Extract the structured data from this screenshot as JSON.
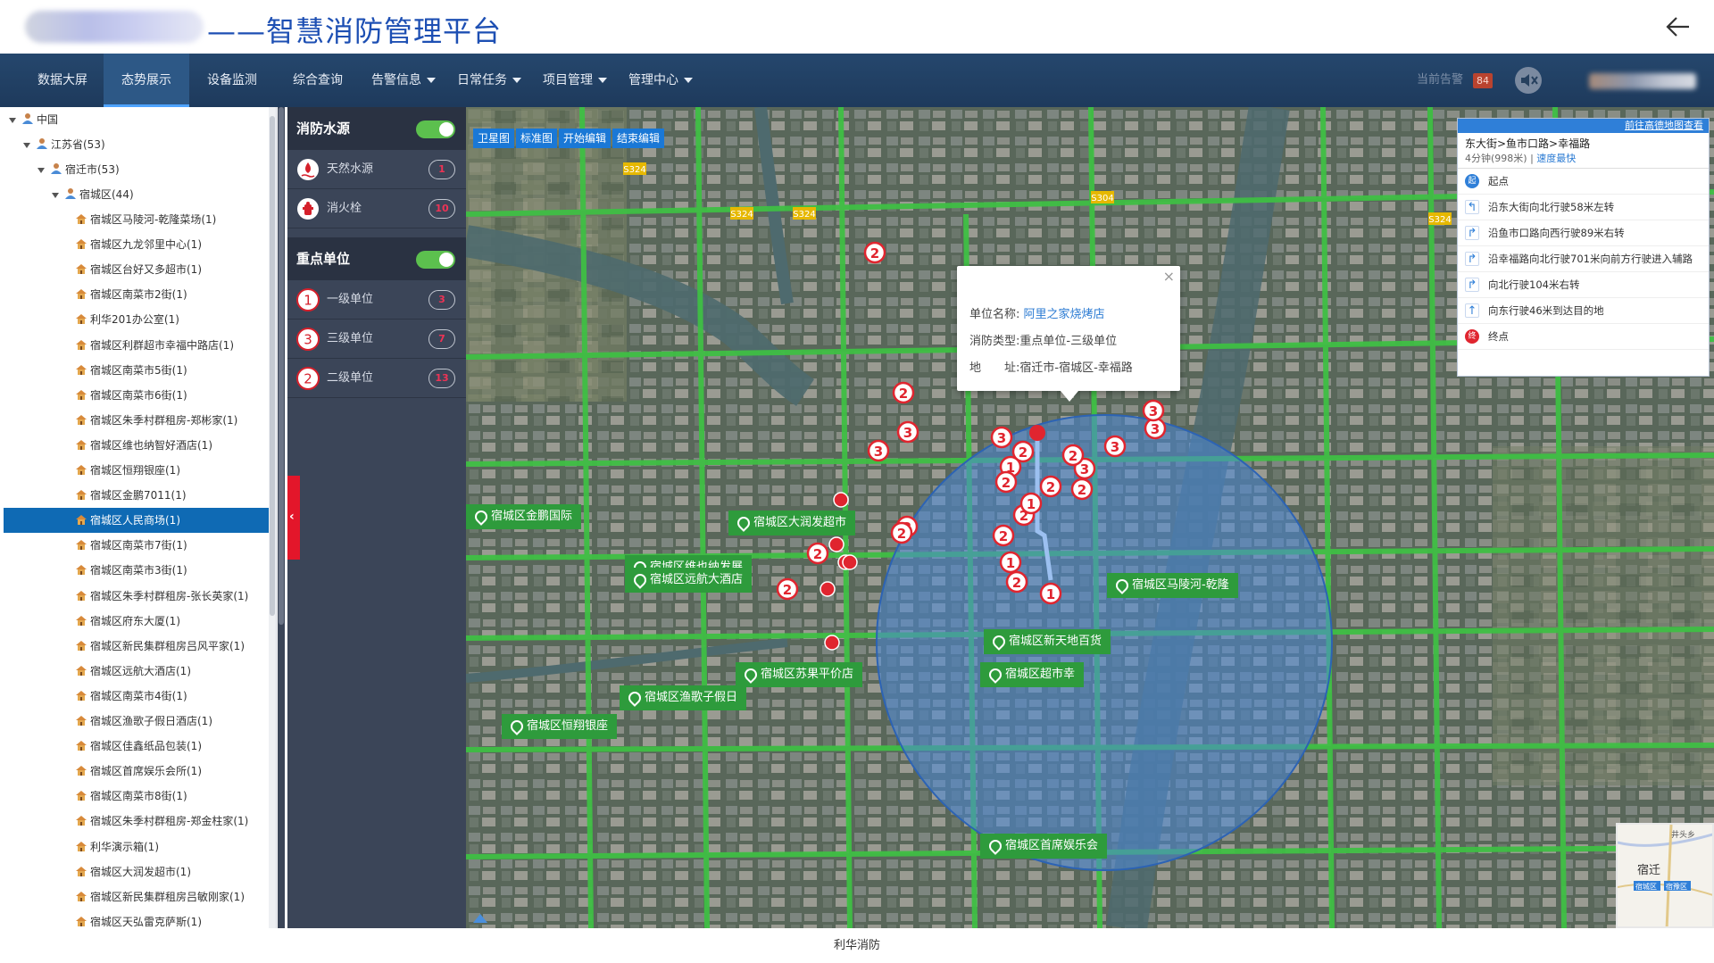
{
  "header": {
    "title": "——智慧消防管理平台"
  },
  "nav": {
    "items": [
      {
        "label": "数据大屏"
      },
      {
        "label": "态势展示"
      },
      {
        "label": "设备监测"
      },
      {
        "label": "综合查询"
      },
      {
        "label": "告警信息"
      },
      {
        "label": "日常任务"
      },
      {
        "label": "项目管理"
      },
      {
        "label": "管理中心"
      }
    ],
    "active": "态势展示",
    "alarm_label": "当前告警",
    "alarm_count": "84"
  },
  "tree": {
    "root": "中国",
    "province": "江苏省(53)",
    "city": "宿迁市(53)",
    "district": "宿城区(44)",
    "items": [
      "宿城区马陵河-乾隆菜场(1)",
      "宿城区九龙邻里中心(1)",
      "宿城区台好又多超市(1)",
      "宿城区南菜市2街(1)",
      "利华201办公室(1)",
      "宿城区利群超市幸福中路店(1)",
      "宿城区南菜市5街(1)",
      "宿城区南菜市6街(1)",
      "宿城区朱季村群租房-郑彬家(1)",
      "宿城区维也纳智好酒店(1)",
      "宿城区恒翔银座(1)",
      "宿城区金鹏7011(1)",
      "宿城区人民商场(1)",
      "宿城区南菜市7街(1)",
      "宿城区南菜市3街(1)",
      "宿城区朱季村群租房-张长英家(1)",
      "宿城区府东大厦(1)",
      "宿城区新民集群租房吕风平家(1)",
      "宿城区远航大酒店(1)",
      "宿城区南菜市4街(1)",
      "宿城区渔歌子假日酒店(1)",
      "宿城区佳鑫纸品包装(1)",
      "宿城区首席娱乐会所(1)",
      "宿城区南菜市8街(1)",
      "宿城区朱季村群租房-郑金柱家(1)",
      "利华演示箱(1)",
      "宿城区大润发超市(1)",
      "宿城区新民集群租房吕敏刚家(1)",
      "宿城区天弘雷克萨斯(1)"
    ],
    "selected": "宿城区人民商场(1)"
  },
  "layers": {
    "water": {
      "title": "消防水源",
      "rows": [
        {
          "label": "天然水源",
          "count": "1"
        },
        {
          "label": "消火栓",
          "count": "10"
        }
      ]
    },
    "units": {
      "title": "重点单位",
      "rows": [
        {
          "label": "一级单位",
          "count": "3",
          "badge": "1"
        },
        {
          "label": "三级单位",
          "count": "7",
          "badge": "3"
        },
        {
          "label": "二级单位",
          "count": "13",
          "badge": "2"
        }
      ]
    }
  },
  "map": {
    "toolbar": [
      "卫星图",
      "标准图",
      "开始编辑",
      "结束编辑"
    ],
    "labels": [
      "宿城区金鹏国际",
      "宿城区大润发超市",
      "宿城区维也纳发展",
      "宿城区远航大酒店",
      "宿城区马陵河-乾隆",
      "宿城区新天地百货",
      "宿城区苏果平价店",
      "宿城区渔歌子假日",
      "宿城区恒翔银座",
      "宿城区首席娱乐会",
      "宿城区超市幸"
    ],
    "popup": {
      "name_label": "单位名称:",
      "name_value": "阿里之家烧烤店",
      "type_label": "消防类型:",
      "type_value": "重点单位-三级单位",
      "addr_label": "地　　址:",
      "addr_value": "宿迁市-宿城区-幸福路"
    },
    "route": {
      "link": "前往高德地图查看",
      "title": "东大街>鱼市口路>幸福路",
      "distance": "4分钟(998米)",
      "speed": "速度最快",
      "steps": [
        {
          "text": "起点",
          "icon": "start",
          "label": "起"
        },
        {
          "text": "沿东大街向北行驶58米左转",
          "icon": "turn-left"
        },
        {
          "text": "沿鱼市口路向西行驶89米右转",
          "icon": "turn-right"
        },
        {
          "text": "沿幸福路向北行驶701米向前方行驶进入辅路",
          "icon": "turn-right"
        },
        {
          "text": "向北行驶104米右转",
          "icon": "turn-right"
        },
        {
          "text": "向东行驶46米到达目的地",
          "icon": "straight"
        },
        {
          "text": "终点",
          "icon": "end",
          "label": "终"
        }
      ]
    },
    "minimap_labels": [
      "井头乡",
      "宿迁",
      "宿城区",
      "宿豫区"
    ],
    "colors": {
      "circle": "#4a88d8",
      "road": "#3fbf44",
      "marker": "#e0252f",
      "label_bg": "#2e9b3c"
    }
  },
  "footer": {
    "text": "利华消防"
  }
}
